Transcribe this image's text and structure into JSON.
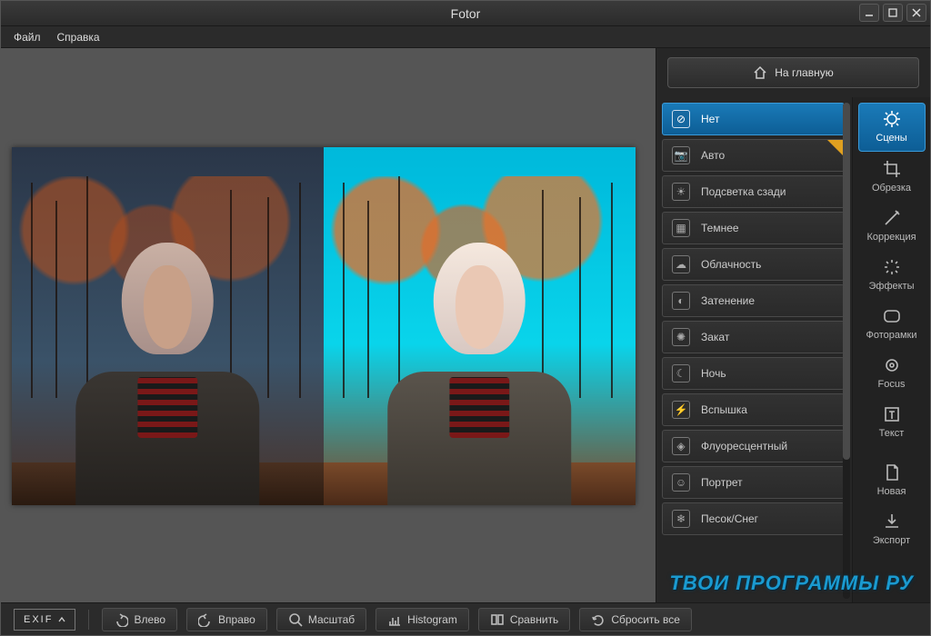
{
  "window": {
    "title": "Fotor"
  },
  "menu": {
    "file": "Файл",
    "help": "Справка"
  },
  "rightPanel": {
    "homeButton": "На главную",
    "scenes": [
      {
        "label": "Нет",
        "icon": "⊘",
        "selected": true
      },
      {
        "label": "Авто",
        "icon": "📷",
        "badge": true
      },
      {
        "label": "Подсветка сзади",
        "icon": "☀"
      },
      {
        "label": "Темнее",
        "icon": "▦"
      },
      {
        "label": "Облачность",
        "icon": "☁"
      },
      {
        "label": "Затенение",
        "icon": "◐"
      },
      {
        "label": "Закат",
        "icon": "✺"
      },
      {
        "label": "Ночь",
        "icon": "☾"
      },
      {
        "label": "Вспышка",
        "icon": "⚡"
      },
      {
        "label": "Флуоресцентный",
        "icon": "◈"
      },
      {
        "label": "Портрет",
        "icon": "☺"
      },
      {
        "label": "Песок/Снег",
        "icon": "❄"
      }
    ],
    "tools": [
      {
        "label": "Сцены",
        "name": "scenes",
        "selected": true
      },
      {
        "label": "Обрезка",
        "name": "crop"
      },
      {
        "label": "Коррекция",
        "name": "adjust"
      },
      {
        "label": "Эффекты",
        "name": "effects"
      },
      {
        "label": "Фоторамки",
        "name": "frames"
      },
      {
        "label": "Focus",
        "name": "focus"
      },
      {
        "label": "Текст",
        "name": "text"
      },
      {
        "label": "Новая",
        "name": "new"
      },
      {
        "label": "Экспорт",
        "name": "export"
      }
    ]
  },
  "bottomBar": {
    "exif": "EXIF",
    "buttons": [
      {
        "label": "Влево",
        "name": "rotate-left"
      },
      {
        "label": "Вправо",
        "name": "rotate-right"
      },
      {
        "label": "Масштаб",
        "name": "zoom"
      },
      {
        "label": "Histogram",
        "name": "histogram"
      },
      {
        "label": "Сравнить",
        "name": "compare"
      },
      {
        "label": "Сбросить все",
        "name": "reset"
      }
    ]
  },
  "watermark": "ТВОИ ПРОГРАММЫ РУ"
}
